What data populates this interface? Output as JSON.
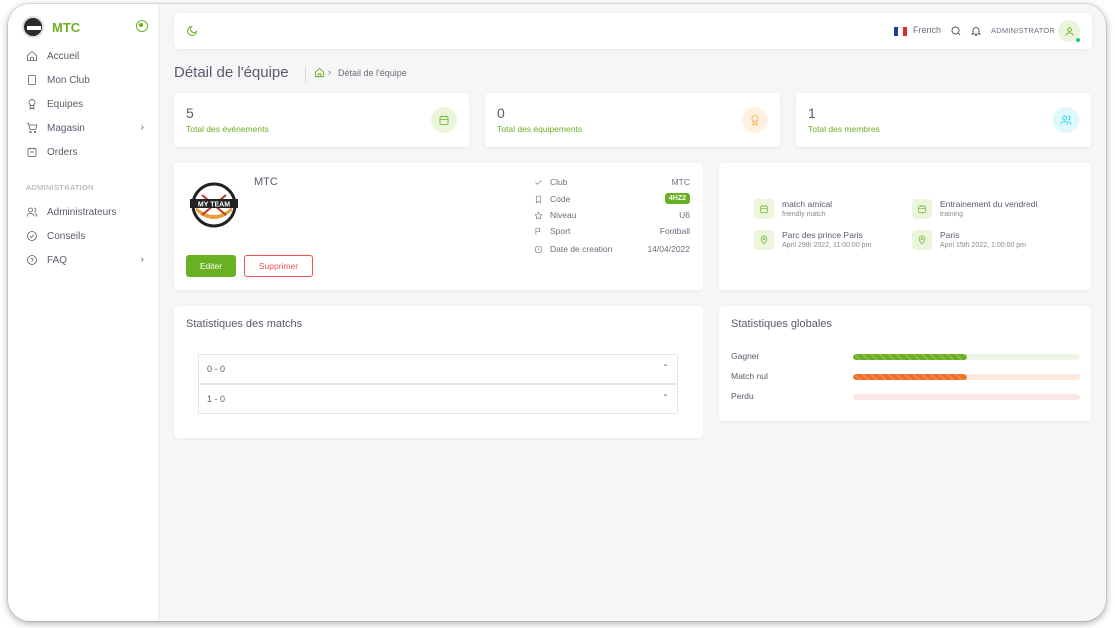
{
  "sidebar": {
    "brand": "MTC",
    "items": [
      {
        "label": "Accueil",
        "icon": "home-icon"
      },
      {
        "label": "Mon Club",
        "icon": "club-icon"
      },
      {
        "label": "Equipes",
        "icon": "award-icon"
      },
      {
        "label": "Magasin",
        "icon": "cart-icon",
        "has_submenu": true
      },
      {
        "label": "Orders",
        "icon": "orders-icon"
      }
    ],
    "section_label": "ADMINISTRATION",
    "admin_items": [
      {
        "label": "Administrateurs",
        "icon": "users-icon"
      },
      {
        "label": "Conseils",
        "icon": "check-circle-icon"
      },
      {
        "label": "FAQ",
        "icon": "help-icon",
        "has_submenu": true
      }
    ]
  },
  "topbar": {
    "language": "French",
    "role": "ADMINISTRATOR"
  },
  "page": {
    "title": "Détail de l'équipe",
    "breadcrumb_current": "Détail de l'équipe"
  },
  "stats": [
    {
      "value": "5",
      "label": "Total des événements",
      "icon": "calendar-icon",
      "color": "#6ab023",
      "bg": "#eaf5dc"
    },
    {
      "value": "0",
      "label": "Total des équipements",
      "icon": "award-icon",
      "color": "#ff9f43",
      "bg": "#fff0e1"
    },
    {
      "value": "1",
      "label": "Total des membres",
      "icon": "users-icon",
      "color": "#00cfe8",
      "bg": "#e0f9fc"
    }
  ],
  "team": {
    "name": "MTC",
    "logo_text": "MY TEAM",
    "edit_label": "Editer",
    "delete_label": "Supprimer",
    "info": [
      {
        "key": "Club",
        "value": "MTC",
        "icon": "check-icon"
      },
      {
        "key": "Code",
        "value": "4HZ2",
        "icon": "bookmark-icon",
        "badge": true
      },
      {
        "key": "Niveau",
        "value": "U6",
        "icon": "star-icon"
      },
      {
        "key": "Sport",
        "value": "Football",
        "icon": "flag-icon"
      },
      {
        "key": "Date de creation",
        "value": "14/04/2022",
        "icon": "clock-icon"
      }
    ]
  },
  "events": [
    {
      "title": "match amical",
      "subtitle": "friendly match",
      "location": "Parc des prince Paris",
      "date": "April 29th 2022, 11:00:00 pm"
    },
    {
      "title": "Entrainement du vendredi",
      "subtitle": "training",
      "location": "Paris",
      "date": "April 15th 2022, 1:00:00 pm"
    }
  ],
  "match_stats": {
    "title": "Statistiques des matchs",
    "scores": [
      "0 - 0",
      "1 - 0"
    ]
  },
  "global_stats": {
    "title": "Statistiques globales",
    "rows": [
      {
        "label": "Gagner",
        "progress": 0.5,
        "color": "#6ab023",
        "track": "#eef5e4"
      },
      {
        "label": "Match nul",
        "progress": 0.5,
        "color": "#f0702a",
        "track": "#fde8df"
      },
      {
        "label": "Perdu",
        "progress": 0,
        "color": "#ea5455",
        "track": "#fde6e6"
      }
    ]
  }
}
